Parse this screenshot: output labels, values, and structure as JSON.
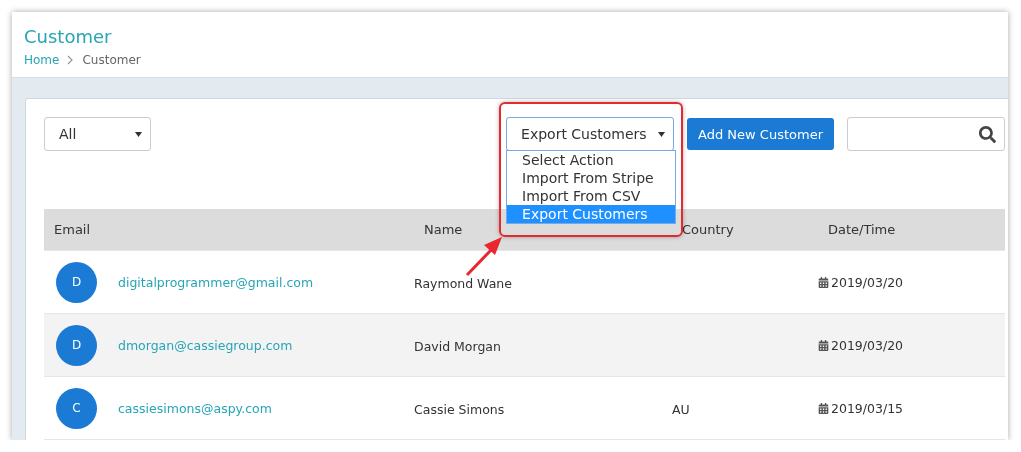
{
  "page": {
    "title": "Customer",
    "breadcrumb": [
      {
        "label": "Home",
        "kind": "link"
      },
      {
        "label": "Customer",
        "kind": "current"
      }
    ]
  },
  "filter": {
    "value": "All"
  },
  "action_select": {
    "value": "Export Customers",
    "expanded": true,
    "options": [
      {
        "label": "Select Action",
        "selected": false
      },
      {
        "label": "Import From Stripe",
        "selected": false
      },
      {
        "label": "Import From CSV",
        "selected": false
      },
      {
        "label": "Export Customers",
        "selected": true
      }
    ]
  },
  "add_button": "Add New Customer",
  "table": {
    "columns": [
      "Email",
      "Name",
      "Country",
      "Date/Time"
    ],
    "rows": [
      {
        "initial": "D",
        "email": "digitalprogrammer@gmail.com",
        "name": "Raymond Wane",
        "date": "2019/03/20"
      },
      {
        "initial": "D",
        "email": "dmorgan@cassiegroup.com",
        "name": "David Morgan",
        "date": "2019/03/20"
      },
      {
        "initial": "C",
        "email": "cassiesimons@aspy.com",
        "name": "Cassie Simons",
        "country": "AU",
        "date": "2019/03/15"
      }
    ]
  }
}
